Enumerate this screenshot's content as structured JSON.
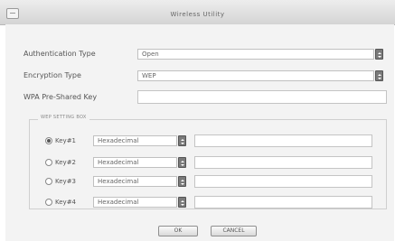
{
  "window": {
    "title": "Wireless Utility"
  },
  "form": {
    "auth_label": "Authentication Type",
    "auth_value": "Open",
    "enc_label": "Encryption Type",
    "enc_value": "WEP",
    "wpa_label": "WPA Pre-Shared Key",
    "wpa_value": ""
  },
  "wep": {
    "legend": "WEP SETTING BOX",
    "keys": [
      {
        "label": "Key#1",
        "format": "Hexadecimal",
        "value": "",
        "selected": true
      },
      {
        "label": "Key#2",
        "format": "Hexadecimal",
        "value": "",
        "selected": false
      },
      {
        "label": "Key#3",
        "format": "Hexadecimal",
        "value": "",
        "selected": false
      },
      {
        "label": "Key#4",
        "format": "Hexadecimal",
        "value": "",
        "selected": false
      }
    ]
  },
  "buttons": {
    "ok": "OK",
    "cancel": "CANCEL"
  }
}
